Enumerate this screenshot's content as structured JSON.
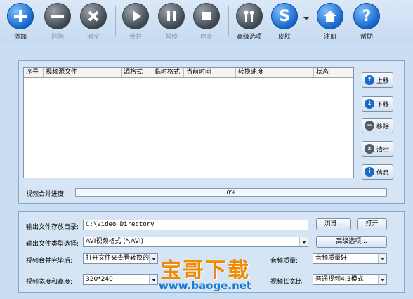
{
  "toolbar": {
    "add": "添加",
    "delete": "删除",
    "clear": "清空",
    "merge": "合并",
    "pause": "暂停",
    "stop": "停止",
    "advanced": "高级选项",
    "skin": "皮肤",
    "register": "注册",
    "help": "帮助"
  },
  "list": {
    "columns": [
      "序号",
      "视频源文件",
      "源格式",
      "临时格式",
      "当前时间",
      "转换速度",
      "状态"
    ]
  },
  "side_buttons": {
    "move_up": "上移",
    "move_down": "下移",
    "remove": "移除",
    "clear": "清空",
    "info": "信息"
  },
  "progress": {
    "label": "视频合并进度:",
    "value": "0%"
  },
  "settings": {
    "output_dir_label": "输出文件存放目录:",
    "output_dir_value": "C:\\Video_Directory",
    "browse": "浏览...",
    "open": "打开",
    "type_label": "输出文件类型选择:",
    "type_value": "AVI视频格式 (*.AVI)",
    "advanced": "高级选项...",
    "after_label": "视频合并完毕后:",
    "after_value": "打开文件夹查看转换的",
    "audio_q_label": "音频质量:",
    "audio_q_value": "音频质量好",
    "size_label": "视频宽度和高度:",
    "size_value": "320*240",
    "aspect_label": "视频长宽比:",
    "aspect_value": "普通视频4:3模式"
  },
  "watermark": {
    "main": "宝哥下载",
    "sub": "www.baoge.net"
  }
}
